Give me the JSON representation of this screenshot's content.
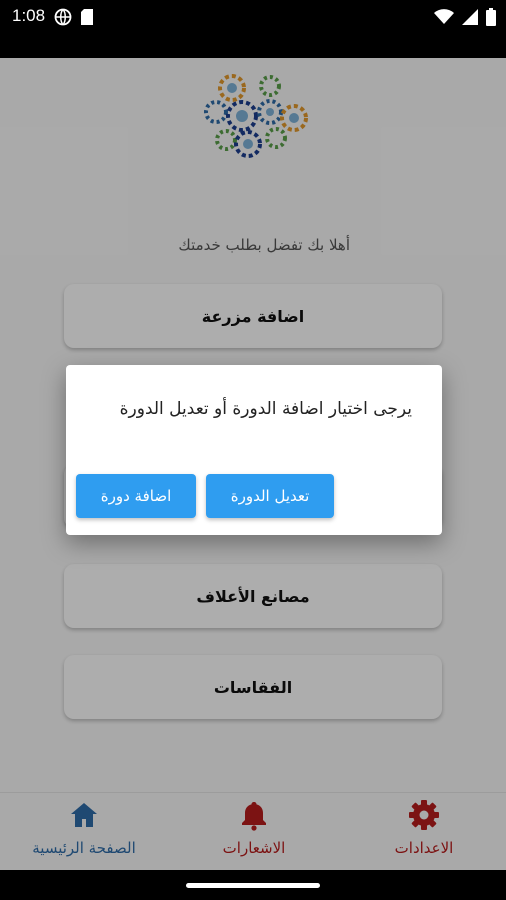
{
  "status_bar": {
    "time": "1:08",
    "left_icons": [
      "globe-icon",
      "sim-card-icon"
    ],
    "right_icons": [
      "wifi-icon",
      "signal-icon",
      "battery-icon"
    ]
  },
  "home": {
    "greeting": "أهلا بك تفضل بطلب خدمتك",
    "menu_items": [
      "اضافة مزرعة",
      "مصانع الأعلاف",
      "الفقاسات"
    ]
  },
  "dialog": {
    "message": "يرجى اختيار اضافة الدورة أو تعديل الدورة",
    "edit_cycle_button": "تعديل الدورة",
    "add_cycle_button": "اضافة دورة",
    "button_color": "#2f9df0"
  },
  "bottom_nav": {
    "items": [
      {
        "label": "الصفحة الرئيسية",
        "icon": "home-icon",
        "color": "#2f6ca8"
      },
      {
        "label": "الاشعارات",
        "icon": "bell-icon",
        "color": "#b71c1c"
      },
      {
        "label": "الاعدادات",
        "icon": "gear-icon",
        "color": "#b71c1c"
      }
    ]
  }
}
